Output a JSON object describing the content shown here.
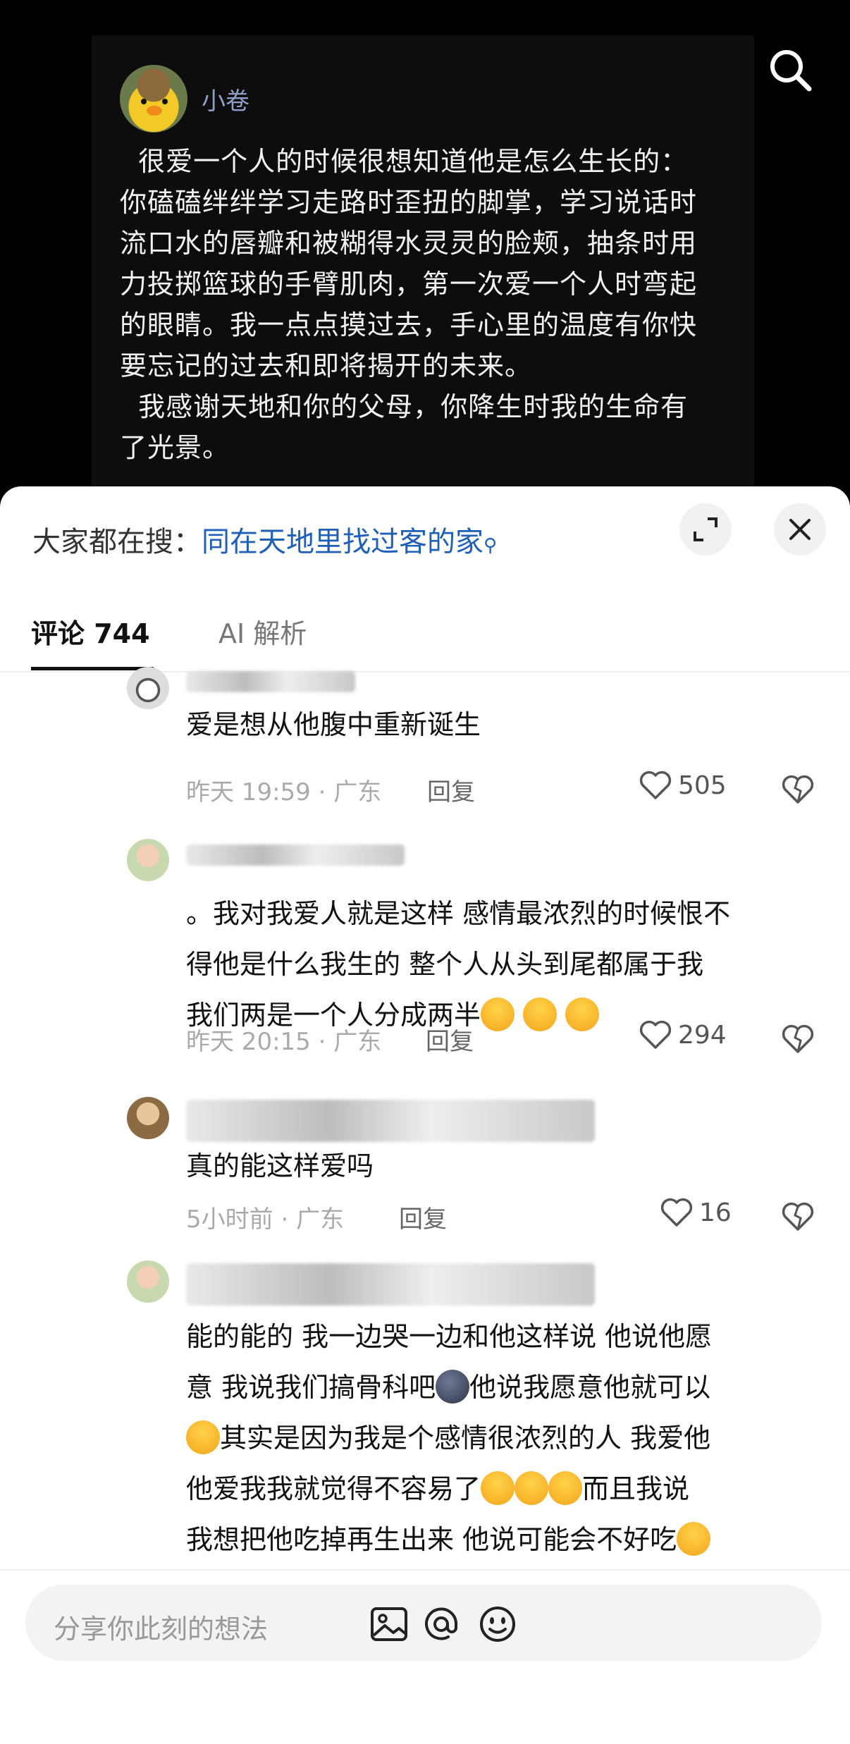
{
  "post": {
    "author": "小卷",
    "text": "  很爱一个人的时候很想知道他是怎么生长的：\n你磕磕绊绊学习走路时歪扭的脚掌，学习说话时\n流口水的唇瓣和被糊得水灵灵的脸颊，抽条时用\n力投掷篮球的手臂肌肉，第一次爱一个人时弯起\n的眼睛。我一点点摸过去，手心里的温度有你快\n要忘记的过去和即将揭开的未来。\n  我感谢天地和你的父母，你降生时我的生命有\n了光景。"
  },
  "sheet": {
    "hot_search_prefix": "大家都在搜：",
    "hot_search_query": "同在天地里找过客的家",
    "tabs": [
      {
        "label": "评论 744"
      },
      {
        "label": "AI 解析"
      }
    ]
  },
  "comments": [
    {
      "text": "爱是想从他腹中重新诞生",
      "time": "昨天 19:59",
      "location": "广东",
      "reply": "回复",
      "likes": "505"
    },
    {
      "text": "。我对我爱人就是这样 感情最浓烈的时候恨不\n得他是什么我生的 整个人从头到尾都属于我\n我们两是一个人分成两半",
      "time": "昨天 20:15",
      "location": "广东",
      "reply": "回复",
      "likes": "294"
    },
    {
      "text": "真的能这样爱吗",
      "time": "5小时前",
      "location": "广东",
      "reply": "回复",
      "likes": "16"
    },
    {
      "text_lines": [
        "能的能的 我一边哭一边和他这样说 他说他愿",
        "意 我说我们搞骨科吧",
        "他说我愿意他就可以",
        "其实是因为我是个感情很浓烈的人 我爱他",
        "他爱我我就觉得不容易了",
        "而且我说",
        "我想把他吃掉再生出来 他说可能会不好吃"
      ]
    }
  ],
  "input": {
    "placeholder": "分享你此刻的想法"
  },
  "icons": {
    "search": "search-icon",
    "expand": "expand-icon",
    "close": "close-icon",
    "heart": "heart-icon",
    "dislike": "broken-heart-icon",
    "image": "image-icon",
    "at": "at-icon",
    "emoji": "emoji-icon"
  }
}
